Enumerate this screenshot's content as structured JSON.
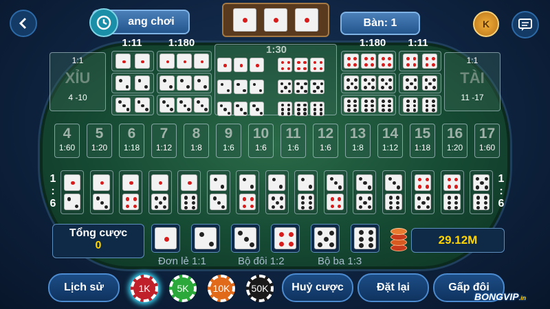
{
  "header": {
    "back_icon": "arrow-left-icon",
    "history_icon": "history-icon",
    "room_label": "ang chơi",
    "table_label": "Bàn: 1",
    "coin_icon": "coin-k-icon",
    "coin_letter": "K",
    "chat_icon": "chat-icon"
  },
  "odds_top": {
    "single_pair": "1:11",
    "triple_any": "1:180",
    "any_triple": "1:30",
    "triple_right": "1:180",
    "pair_right": "1:11"
  },
  "xiu": {
    "ratio": "1:1",
    "label": "XỈU",
    "range": "4 -10"
  },
  "tai": {
    "ratio": "1:1",
    "label": "TÀI",
    "range": "11 -17"
  },
  "totals": [
    {
      "n": "4",
      "o": "1:60"
    },
    {
      "n": "5",
      "o": "1:20"
    },
    {
      "n": "6",
      "o": "1:18"
    },
    {
      "n": "7",
      "o": "1:12"
    },
    {
      "n": "8",
      "o": "1:8"
    },
    {
      "n": "9",
      "o": "1:6"
    },
    {
      "n": "10",
      "o": "1:6"
    },
    {
      "n": "11",
      "o": "1:6"
    },
    {
      "n": "12",
      "o": "1:6"
    },
    {
      "n": "13",
      "o": "1:8"
    },
    {
      "n": "14",
      "o": "1:12"
    },
    {
      "n": "15",
      "o": "1:18"
    },
    {
      "n": "16",
      "o": "1:20"
    },
    {
      "n": "17",
      "o": "1:60"
    }
  ],
  "combo_side": {
    "l1": "1",
    "l2": ":",
    "l3": "6"
  },
  "bet": {
    "total_label": "Tổng cược",
    "total_value": "0",
    "balance": "29.12M"
  },
  "payouts": {
    "single": "Đơn lẻ 1:1",
    "double": "Bộ đôi 1:2",
    "triple": "Bộ ba 1:3"
  },
  "chips": [
    {
      "label": "1K",
      "color": "#c0202a"
    },
    {
      "label": "5K",
      "color": "#2aa83a"
    },
    {
      "label": "10K",
      "color": "#e06a1a"
    },
    {
      "label": "50K",
      "color": "#1a1a1a"
    }
  ],
  "buttons": {
    "history": "Lịch sử",
    "cancel": "Huỷ cược",
    "reset": "Đặt lại",
    "double": "Gấp đôi"
  },
  "brand": {
    "logo_text": "BONGVIP",
    "suffix": ".in"
  }
}
